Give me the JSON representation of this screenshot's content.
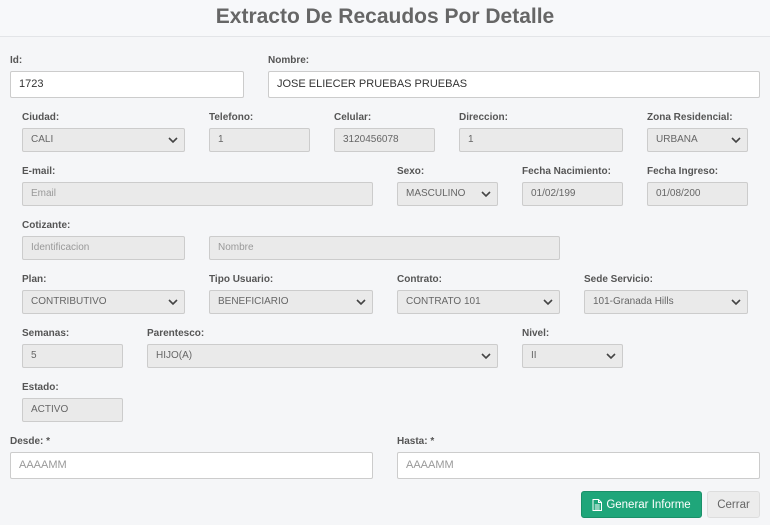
{
  "title": "Extracto De Recaudos Por Detalle",
  "labels": {
    "id": "Id:",
    "nombre": "Nombre:",
    "ciudad": "Ciudad:",
    "telefono": "Telefono:",
    "celular": "Celular:",
    "direccion": "Direccion:",
    "zona": "Zona Residencial:",
    "email": "E-mail:",
    "sexo": "Sexo:",
    "fecha_nac": "Fecha Nacimiento:",
    "fecha_ing": "Fecha Ingreso:",
    "cotizante": "Cotizante:",
    "plan": "Plan:",
    "tipo_usuario": "Tipo Usuario:",
    "contrato": "Contrato:",
    "sede": "Sede Servicio:",
    "semanas": "Semanas:",
    "parentesco": "Parentesco:",
    "nivel": "Nivel:",
    "estado": "Estado:",
    "desde": "Desde: *",
    "hasta": "Hasta: *"
  },
  "values": {
    "id": "1723",
    "nombre": "JOSE ELIECER PRUEBAS PRUEBAS",
    "ciudad": "CALI",
    "telefono": "1",
    "celular": "3120456078",
    "direccion": "1",
    "zona": "URBANA",
    "sexo": "MASCULINO",
    "fecha_nac": "01/02/199",
    "fecha_ing": "01/08/200",
    "plan": "CONTRIBUTIVO",
    "tipo_usuario": "BENEFICIARIO",
    "contrato": "CONTRATO 101",
    "sede": "101-Granada Hills",
    "semanas": "5",
    "parentesco": "HIJO(A)",
    "nivel": "II",
    "estado": "ACTIVO"
  },
  "placeholders": {
    "email": "Email",
    "cotizante_id": "Identificacion",
    "cotizante_nombre": "Nombre",
    "desde": "AAAAMM",
    "hasta": "AAAAMM"
  },
  "buttons": {
    "generar": "Generar Informe",
    "cerrar": "Cerrar"
  },
  "colors": {
    "primary": "#1fa67a",
    "readonly_bg": "#eaeaea"
  }
}
